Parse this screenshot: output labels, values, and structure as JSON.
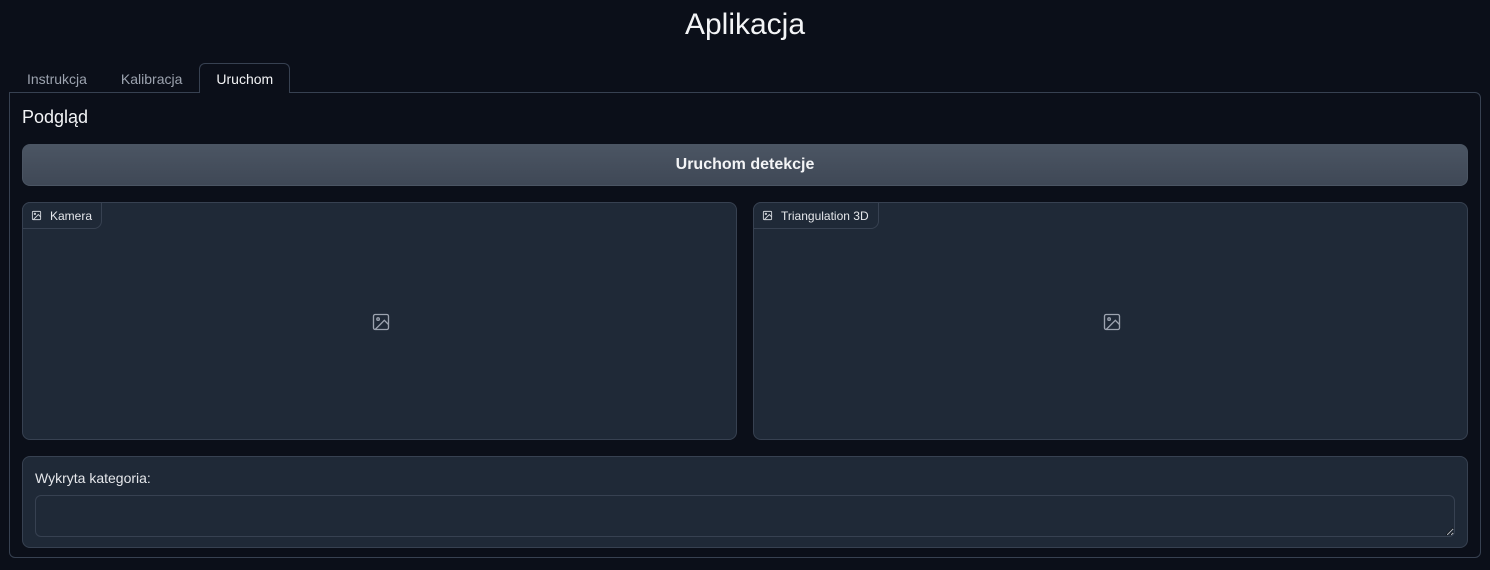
{
  "app": {
    "title": "Aplikacja"
  },
  "tabs": [
    {
      "label": "Instrukcja",
      "active": false
    },
    {
      "label": "Kalibracja",
      "active": false
    },
    {
      "label": "Uruchom",
      "active": true
    }
  ],
  "panel": {
    "section_title": "Podgląd",
    "run_button_label": "Uruchom detekcje",
    "images": [
      {
        "label": "Kamera",
        "icon": "image-icon"
      },
      {
        "label": "Triangulation 3D",
        "icon": "image-icon"
      }
    ],
    "category": {
      "label": "Wykryta kategoria:",
      "value": ""
    }
  },
  "colors": {
    "background": "#0b0f19",
    "panel_border": "#374151",
    "box_background": "#1f2937",
    "button": "#4b5563"
  }
}
